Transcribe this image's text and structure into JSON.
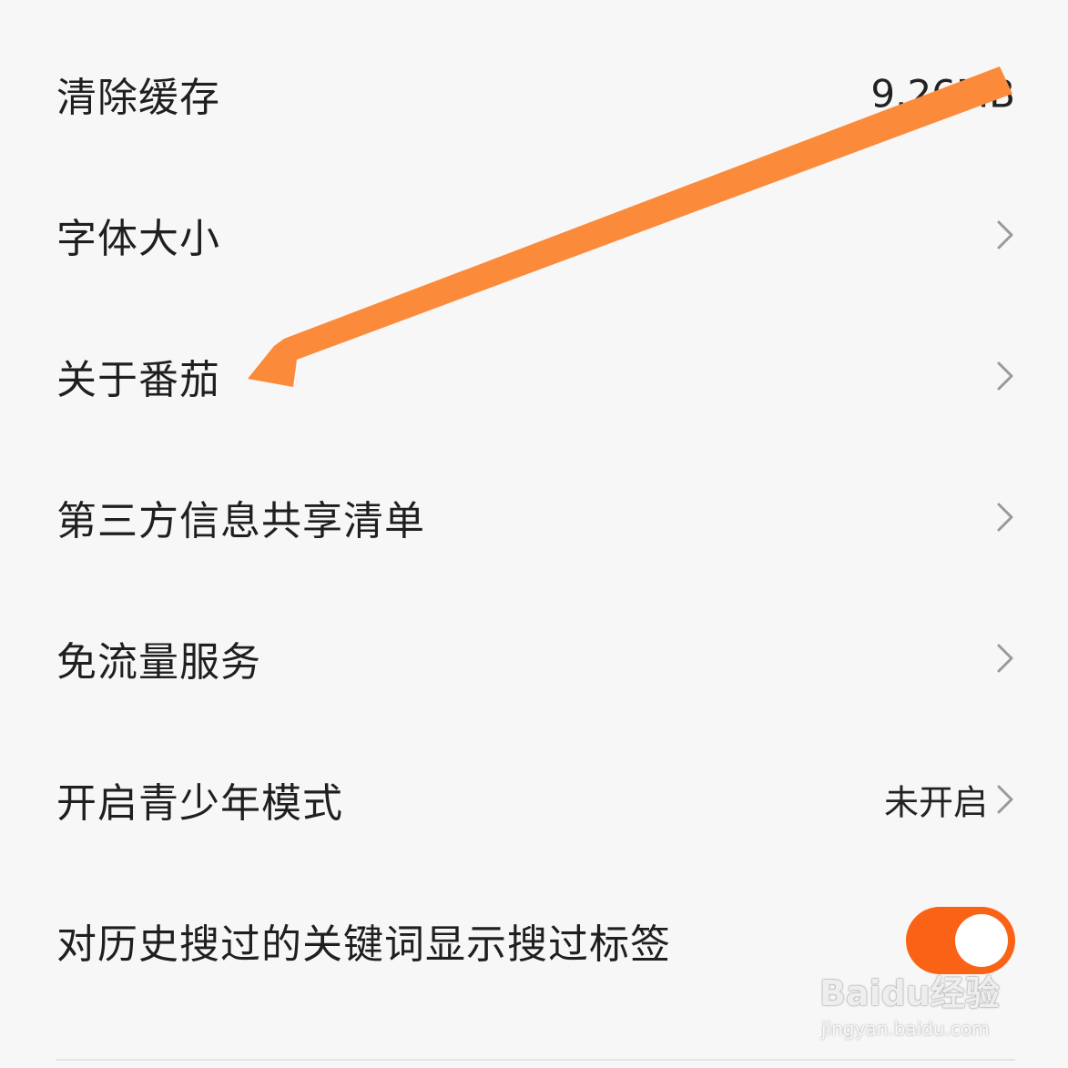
{
  "settings": {
    "items": [
      {
        "label": "清除缓存",
        "value": "9.26MB"
      },
      {
        "label": "字体大小"
      },
      {
        "label": "关于番茄"
      },
      {
        "label": "第三方信息共享清单"
      },
      {
        "label": "免流量服务"
      },
      {
        "label": "开启青少年模式",
        "value": "未开启"
      },
      {
        "label": "对历史搜过的关键词显示搜过标签",
        "toggle": true
      }
    ]
  },
  "icons": {
    "chevron": "chevron-right-icon",
    "toggle": "toggle-switch-on"
  },
  "colors": {
    "background": "#f7f7f7",
    "text": "#1f1f1f",
    "accent": "#fa6216",
    "annotation_arrow": "#fb8a3a"
  },
  "watermark": {
    "main": "Baidu经验",
    "sub": "jingyan.baidu.com"
  }
}
